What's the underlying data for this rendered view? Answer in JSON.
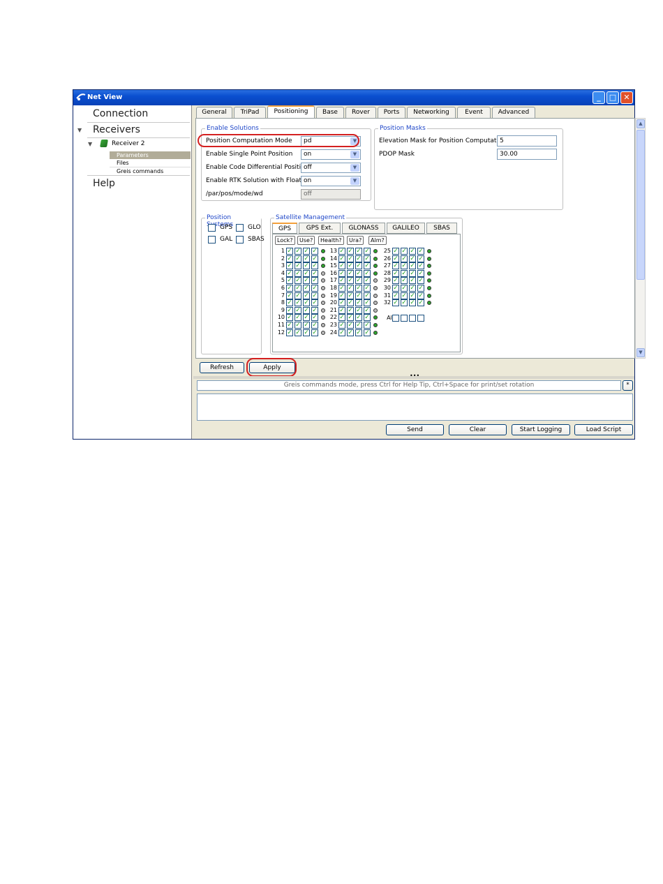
{
  "window": {
    "title": "Net View"
  },
  "nav": {
    "connection": "Connection",
    "receivers": "Receivers",
    "receiver": "Receiver 2",
    "parameters": "Parameters",
    "files": "Files",
    "greis": "Greis commands",
    "help": "Help"
  },
  "tabs": [
    "General",
    "TriPad",
    "Positioning",
    "Base",
    "Rover",
    "Ports",
    "Networking",
    "Event",
    "Advanced"
  ],
  "enable_solutions": {
    "title": "Enable Solutions",
    "rows": [
      {
        "label": "Position Computation Mode",
        "value": "pd"
      },
      {
        "label": "Enable Single Point Position",
        "value": "on"
      },
      {
        "label": "Enable Code Differential Position",
        "value": "off"
      },
      {
        "label": "Enable RTK Solution with Float...",
        "value": "on"
      },
      {
        "label": "/par/pos/mode/wd",
        "value": "off"
      }
    ]
  },
  "position_masks": {
    "title": "Position Masks",
    "elevation_label": "Elevation Mask for Position Computation",
    "elevation_value": "5",
    "pdop_label": "PDOP Mask",
    "pdop_value": "30.00"
  },
  "position_systems": {
    "title": "Position Systems",
    "gps": "GPS",
    "glo": "GLO",
    "gal": "GAL",
    "sbas": "SBAS"
  },
  "satellite_management": {
    "title": "Satellite Management",
    "tabs": [
      "GPS",
      "GPS Ext.",
      "GLONASS",
      "GALILEO",
      "SBAS"
    ],
    "headers": [
      "Lock?",
      "Use?",
      "Health?",
      "Ura?",
      "Alm?"
    ],
    "all_label": "All"
  },
  "buttons": {
    "refresh": "Refresh",
    "apply": "Apply",
    "send": "Send",
    "clear": "Clear",
    "start_logging": "Start Logging",
    "load_script": "Load Script"
  },
  "command": {
    "hint": "Greis commands mode, press Ctrl for Help Tip, Ctrl+Space for print/set rotation",
    "star": "*",
    "dots": "•••"
  }
}
